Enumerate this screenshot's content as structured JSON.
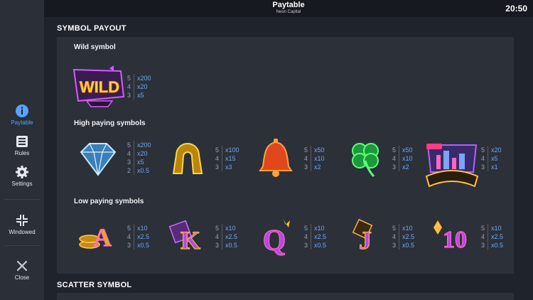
{
  "header": {
    "title": "Paytable",
    "subtitle": "Neon Capital",
    "clock": "20:50"
  },
  "sidebar": {
    "paytable": "Paytable",
    "rules": "Rules",
    "settings": "Settings",
    "windowed": "Windowed",
    "close": "Close"
  },
  "sections": {
    "symbol_payout": "SYMBOL PAYOUT",
    "scatter": "SCATTER SYMBOL"
  },
  "groups": {
    "wild": "Wild symbol",
    "high": "High paying symbols",
    "low": "Low paying symbols"
  },
  "wild": {
    "symbol_text": "WILD",
    "pays": [
      {
        "n": "5",
        "v": "x200"
      },
      {
        "n": "4",
        "v": "x20"
      },
      {
        "n": "3",
        "v": "x5"
      }
    ]
  },
  "high": [
    {
      "name": "diamond",
      "pays": [
        {
          "n": "5",
          "v": "x200"
        },
        {
          "n": "4",
          "v": "x20"
        },
        {
          "n": "3",
          "v": "x5"
        },
        {
          "n": "2",
          "v": "x0.5"
        }
      ]
    },
    {
      "name": "horseshoe",
      "pays": [
        {
          "n": "5",
          "v": "x100"
        },
        {
          "n": "4",
          "v": "x15"
        },
        {
          "n": "3",
          "v": "x3"
        }
      ]
    },
    {
      "name": "bell",
      "pays": [
        {
          "n": "5",
          "v": "x50"
        },
        {
          "n": "4",
          "v": "x10"
        },
        {
          "n": "3",
          "v": "x2"
        }
      ]
    },
    {
      "name": "clover",
      "pays": [
        {
          "n": "5",
          "v": "x50"
        },
        {
          "n": "4",
          "v": "x10"
        },
        {
          "n": "3",
          "v": "x2"
        }
      ]
    },
    {
      "name": "city-sign",
      "pays": [
        {
          "n": "5",
          "v": "x20"
        },
        {
          "n": "4",
          "v": "x5"
        },
        {
          "n": "3",
          "v": "x1"
        }
      ]
    }
  ],
  "low": [
    {
      "name": "A",
      "pays": [
        {
          "n": "5",
          "v": "x10"
        },
        {
          "n": "4",
          "v": "x2.5"
        },
        {
          "n": "3",
          "v": "x0.5"
        }
      ]
    },
    {
      "name": "K",
      "pays": [
        {
          "n": "5",
          "v": "x10"
        },
        {
          "n": "4",
          "v": "x2.5"
        },
        {
          "n": "3",
          "v": "x0.5"
        }
      ]
    },
    {
      "name": "Q",
      "pays": [
        {
          "n": "5",
          "v": "x10"
        },
        {
          "n": "4",
          "v": "x2.5"
        },
        {
          "n": "3",
          "v": "x0.5"
        }
      ]
    },
    {
      "name": "J",
      "pays": [
        {
          "n": "5",
          "v": "x10"
        },
        {
          "n": "4",
          "v": "x2.5"
        },
        {
          "n": "3",
          "v": "x0.5"
        }
      ]
    },
    {
      "name": "10",
      "pays": [
        {
          "n": "5",
          "v": "x10"
        },
        {
          "n": "4",
          "v": "x2.5"
        },
        {
          "n": "3",
          "v": "x0.5"
        }
      ]
    }
  ],
  "colors": {
    "accent": "#5aa2ff",
    "pay_value": "#6eaaf2",
    "panel": "#2c3039"
  }
}
